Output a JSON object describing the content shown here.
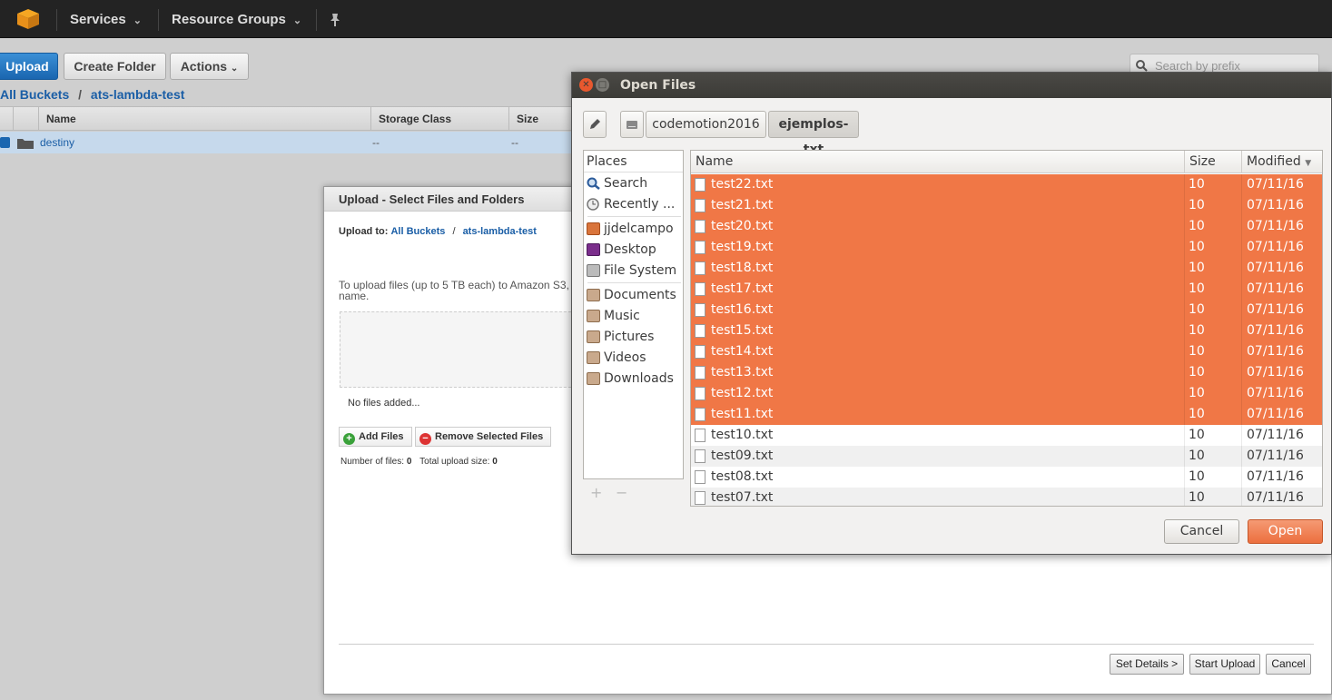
{
  "topbar": {
    "services_label": "Services",
    "resource_groups_label": "Resource Groups",
    "caret": "⌄",
    "pin_icon": "pin-icon",
    "logo_icon": "aws-cube-icon"
  },
  "toolbar": {
    "upload_label": "Upload",
    "create_folder_label": "Create Folder",
    "actions_label": "Actions",
    "search_placeholder": "Search by prefix"
  },
  "breadcrumb": {
    "all_buckets": "All Buckets",
    "separator": "/",
    "bucket": "ats-lambda-test"
  },
  "table": {
    "columns": [
      "Name",
      "Storage Class",
      "Size"
    ],
    "rows": [
      {
        "name": "destiny",
        "storage_class": "--",
        "size": "--"
      }
    ]
  },
  "upload_dialog": {
    "title": "Upload - Select Files and Folders",
    "upload_to_label": "Upload to:",
    "all_buckets": "All Buckets",
    "separator": "/",
    "bucket": "ats-lambda-test",
    "info_line1": "To upload files (up to 5 TB each) to Amazon S3,",
    "info_line2": "name.",
    "no_files": "No files added...",
    "add_files_label": "Add Files",
    "remove_selected_label": "Remove Selected Files",
    "num_files_label": "Number of files:",
    "num_files_value": "0",
    "total_size_label": "Total upload size:",
    "total_size_value": "0",
    "set_details_label": "Set Details >",
    "start_upload_label": "Start Upload",
    "cancel_label": "Cancel"
  },
  "open_dialog": {
    "title": "Open Files",
    "path": [
      "codemotion2016",
      "ejemplos-txt"
    ],
    "places_header": "Places",
    "places": [
      {
        "label": "Search",
        "icon": "search-icon"
      },
      {
        "label": "Recently ...",
        "icon": "clock-icon"
      },
      {
        "label": "jjdelcampo",
        "icon": "home-folder-icon"
      },
      {
        "label": "Desktop",
        "icon": "desktop-icon"
      },
      {
        "label": "File System",
        "icon": "drive-icon"
      },
      {
        "label": "Documents",
        "icon": "documents-folder-icon"
      },
      {
        "label": "Music",
        "icon": "music-folder-icon"
      },
      {
        "label": "Pictures",
        "icon": "pictures-folder-icon"
      },
      {
        "label": "Videos",
        "icon": "videos-folder-icon"
      },
      {
        "label": "Downloads",
        "icon": "downloads-folder-icon"
      }
    ],
    "plus": "+",
    "minus": "−",
    "columns": {
      "name": "Name",
      "size": "Size",
      "modified": "Modified",
      "sort_arrow": "▼"
    },
    "files": [
      {
        "name": "test22.txt",
        "size": "10 bytes",
        "modified": "07/11/16",
        "selected": true
      },
      {
        "name": "test21.txt",
        "size": "10 bytes",
        "modified": "07/11/16",
        "selected": true
      },
      {
        "name": "test20.txt",
        "size": "10 bytes",
        "modified": "07/11/16",
        "selected": true
      },
      {
        "name": "test19.txt",
        "size": "10 bytes",
        "modified": "07/11/16",
        "selected": true
      },
      {
        "name": "test18.txt",
        "size": "10 bytes",
        "modified": "07/11/16",
        "selected": true
      },
      {
        "name": "test17.txt",
        "size": "10 bytes",
        "modified": "07/11/16",
        "selected": true
      },
      {
        "name": "test16.txt",
        "size": "10 bytes",
        "modified": "07/11/16",
        "selected": true
      },
      {
        "name": "test15.txt",
        "size": "10 bytes",
        "modified": "07/11/16",
        "selected": true
      },
      {
        "name": "test14.txt",
        "size": "10 bytes",
        "modified": "07/11/16",
        "selected": true
      },
      {
        "name": "test13.txt",
        "size": "10 bytes",
        "modified": "07/11/16",
        "selected": true
      },
      {
        "name": "test12.txt",
        "size": "10 bytes",
        "modified": "07/11/16",
        "selected": true
      },
      {
        "name": "test11.txt",
        "size": "10 bytes",
        "modified": "07/11/16",
        "selected": true
      },
      {
        "name": "test10.txt",
        "size": "10 bytes",
        "modified": "07/11/16",
        "selected": false
      },
      {
        "name": "test09.txt",
        "size": "10 bytes",
        "modified": "07/11/16",
        "selected": false
      },
      {
        "name": "test08.txt",
        "size": "10 bytes",
        "modified": "07/11/16",
        "selected": false
      },
      {
        "name": "test07.txt",
        "size": "10 bytes",
        "modified": "07/11/16",
        "selected": false
      }
    ],
    "cancel_label": "Cancel",
    "open_label": "Open"
  },
  "colors": {
    "selection": "#f07746",
    "aws_blue": "#1a5ea6",
    "topbar": "#232323",
    "ubuntu_titlebar": "#3c3b37",
    "close_button": "#e8582e"
  }
}
